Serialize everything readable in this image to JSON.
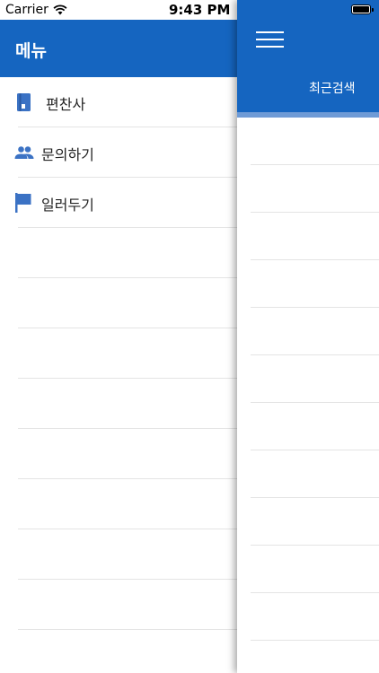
{
  "status_bar": {
    "carrier": "Carrier",
    "time": "9:43 PM",
    "icons": [
      "wifi-icon",
      "battery-icon"
    ]
  },
  "menu": {
    "title": "메뉴",
    "items": [
      {
        "label": "편찬사",
        "icon": "book-icon"
      },
      {
        "label": "문의하기",
        "icon": "people-icon"
      },
      {
        "label": "일러두기",
        "icon": "flag-icon"
      }
    ],
    "empty_rows": 8
  },
  "main": {
    "menu_icon": "hamburger-icon",
    "tab_label": "최근검색",
    "empty_rows": 11
  },
  "colors": {
    "primary": "#1565c0",
    "indicator": "#6f9bd6",
    "icon": "#3b72c4",
    "divider": "#e4e4e4"
  }
}
